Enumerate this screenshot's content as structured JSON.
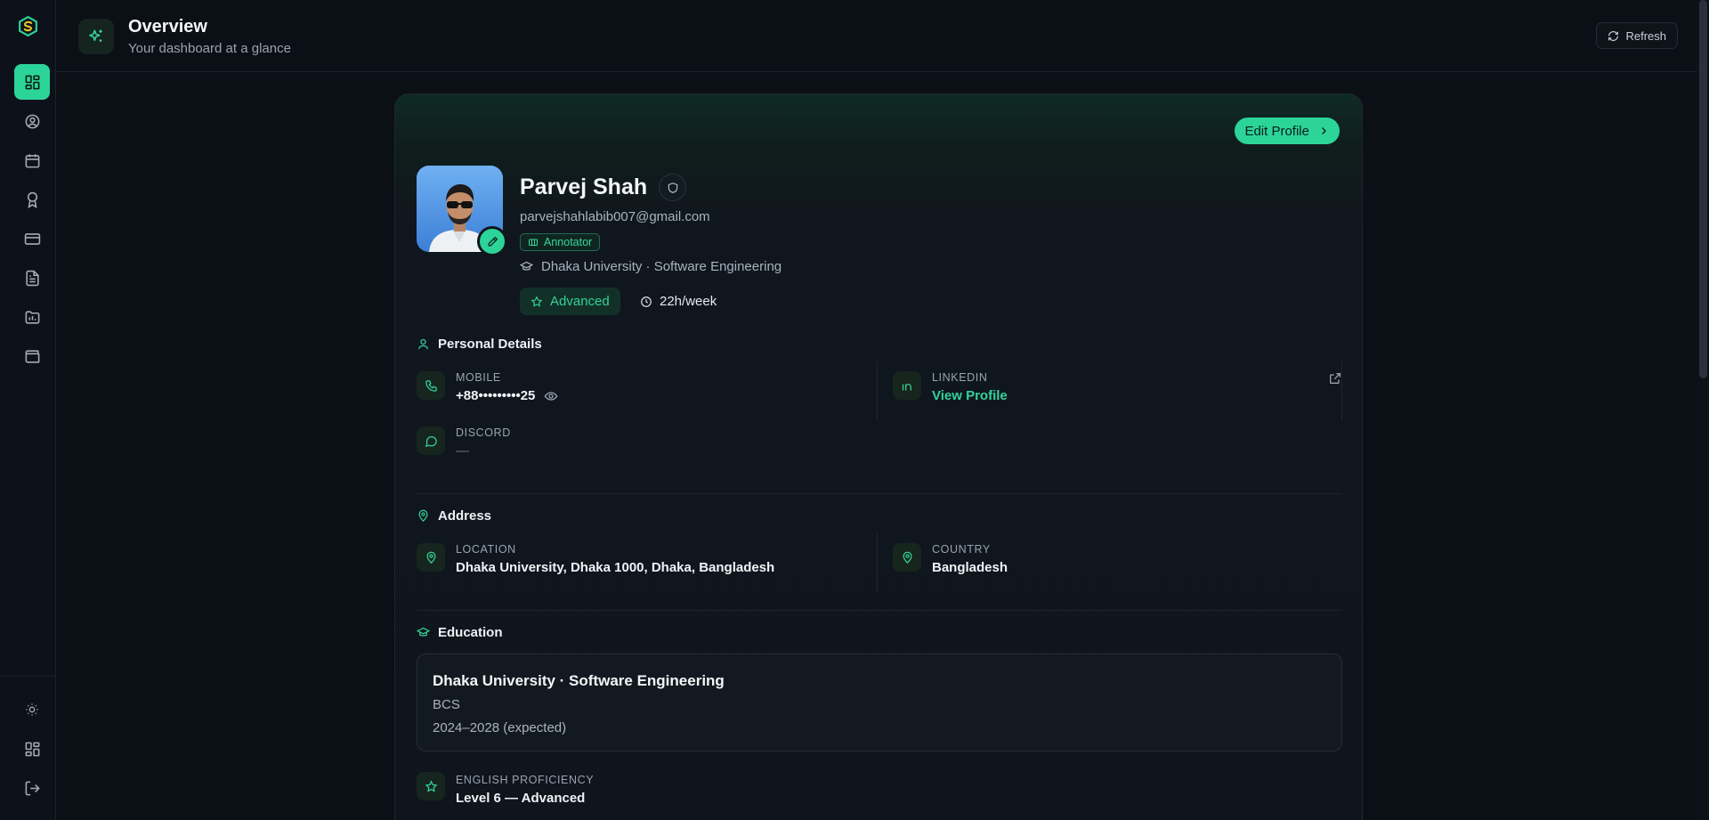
{
  "header": {
    "title": "Overview",
    "subtitle": "Your dashboard at a glance",
    "refresh_label": "Refresh"
  },
  "sidebar": {
    "items": [
      {
        "icon": "dashboard-icon",
        "active": true
      },
      {
        "icon": "user-circle-icon",
        "active": false
      },
      {
        "icon": "calendar-icon",
        "active": false
      },
      {
        "icon": "award-icon",
        "active": false
      },
      {
        "icon": "credit-card-icon",
        "active": false
      },
      {
        "icon": "document-icon",
        "active": false
      },
      {
        "icon": "chart-folder-icon",
        "active": false
      },
      {
        "icon": "wallet-icon",
        "active": false
      }
    ],
    "bottom": [
      "sun-icon",
      "dashboard-icon",
      "logout-icon"
    ]
  },
  "profile": {
    "edit_label": "Edit Profile",
    "name": "Parvej Shah",
    "email": "parvejshahlabib007@gmail.com",
    "role": "Annotator",
    "university_line": "Dhaka University · Software Engineering",
    "level": "Advanced",
    "hours": "22h/week"
  },
  "personal": {
    "title": "Personal Details",
    "mobile_label": "MOBILE",
    "mobile_value": "+88•••••••••25",
    "linkedin_label": "LINKEDIN",
    "linkedin_value": "View Profile",
    "discord_label": "DISCORD",
    "discord_value": "—"
  },
  "address": {
    "title": "Address",
    "location_label": "LOCATION",
    "location_value": "Dhaka University, Dhaka 1000, Dhaka, Bangladesh",
    "country_label": "COUNTRY",
    "country_value": "Bangladesh"
  },
  "education": {
    "title": "Education",
    "institution": "Dhaka University · Software Engineering",
    "degree": "BCS",
    "years": "2024–2028 (expected)",
    "english_label": "ENGLISH PROFICIENCY",
    "english_value": "Level 6 — Advanced"
  },
  "colors": {
    "accent": "#2dd49a",
    "background": "#0b0f16",
    "card": "#10151d"
  }
}
